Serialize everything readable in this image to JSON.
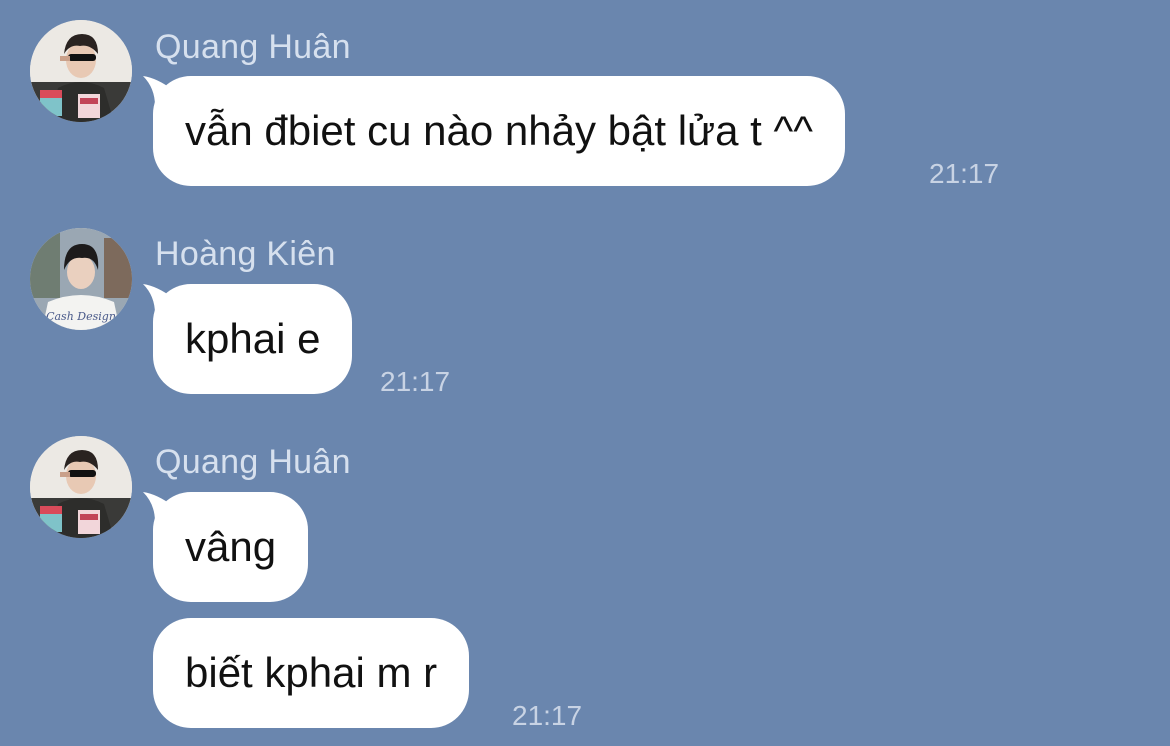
{
  "messages": [
    {
      "sender": "Quang Huân",
      "avatar": "person-with-sunglasses-avatar",
      "text": "vẫn đbiet cu nào nhảy bật lửa t ^^",
      "time": "21:17"
    },
    {
      "sender": "Hoàng Kiên",
      "avatar": "person-in-white-shirt-avatar",
      "text": "kphai e",
      "time": "21:17"
    },
    {
      "sender": "Quang Huân",
      "avatar": "person-with-sunglasses-avatar",
      "text": "vâng",
      "time": ""
    },
    {
      "sender": "",
      "avatar": "",
      "text": "biết kphai m r",
      "time": "21:17"
    }
  ],
  "colors": {
    "background": "#6a86ae",
    "bubble": "#ffffff",
    "sender_name": "#d6e0ee",
    "timestamp": "#c8d3e4"
  }
}
